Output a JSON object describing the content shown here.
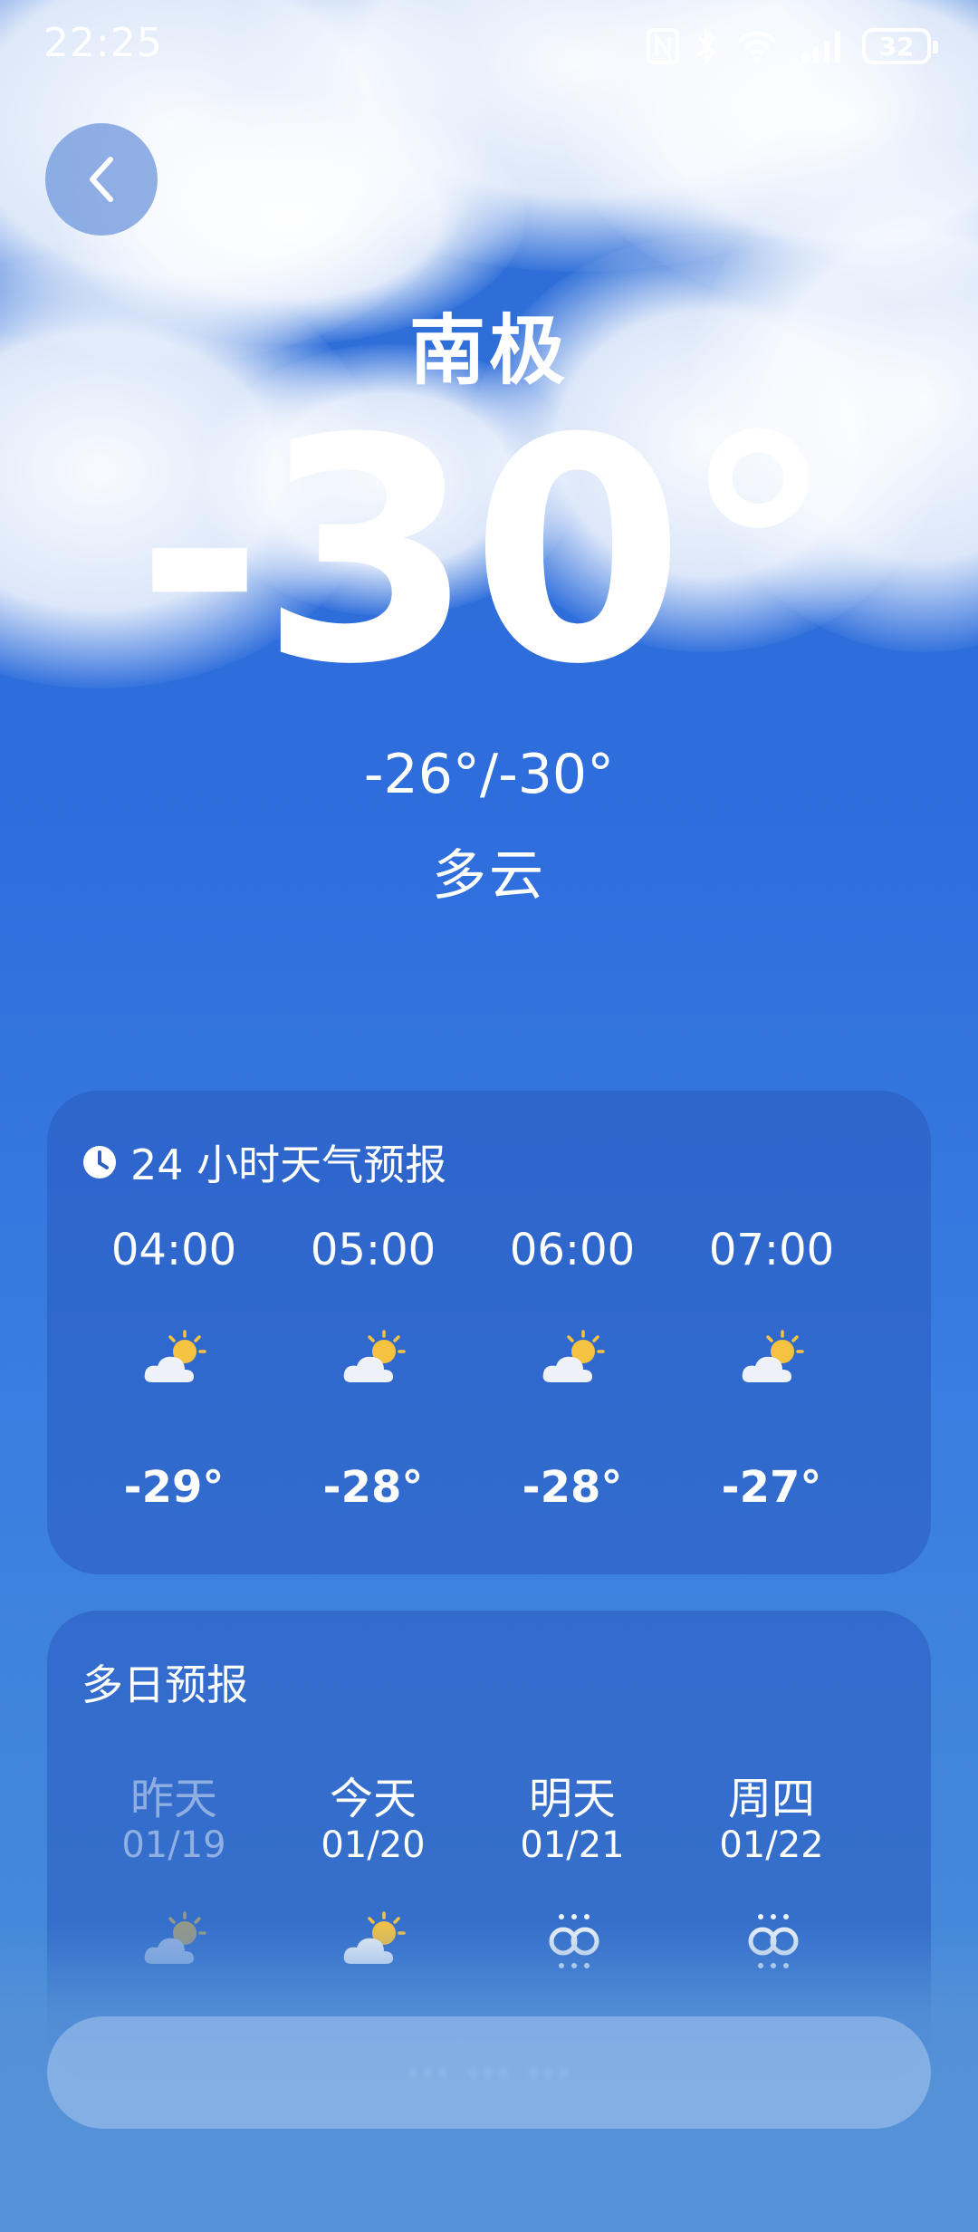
{
  "status_bar": {
    "time": "22:25",
    "battery": "32",
    "icons": [
      "nfc-icon",
      "bluetooth-icon",
      "wifi-icon",
      "signal-5g-icon",
      "battery-icon"
    ]
  },
  "header": {
    "back_icon": "chevron-left-icon"
  },
  "current": {
    "city": "南极",
    "temperature": "-30°",
    "range": "-26°/-30°",
    "condition": "多云"
  },
  "hourly": {
    "title": "24 小时天气预报",
    "title_icon": "clock-icon",
    "items": [
      {
        "time": "04:00",
        "icon": "partly-cloudy-icon",
        "temp": "-29°"
      },
      {
        "time": "05:00",
        "icon": "partly-cloudy-icon",
        "temp": "-28°"
      },
      {
        "time": "06:00",
        "icon": "partly-cloudy-icon",
        "temp": "-28°"
      },
      {
        "time": "07:00",
        "icon": "partly-cloudy-icon",
        "temp": "-27°"
      }
    ]
  },
  "daily": {
    "title": "多日预报",
    "items": [
      {
        "day": "昨天",
        "date": "01/19",
        "icon": "partly-cloudy-icon"
      },
      {
        "day": "今天",
        "date": "01/20",
        "icon": "partly-cloudy-icon"
      },
      {
        "day": "明天",
        "date": "01/21",
        "icon": "snow-icon"
      },
      {
        "day": "周四",
        "date": "01/22",
        "icon": "snow-icon"
      }
    ]
  },
  "colors": {
    "background_top": "#2f6fd6",
    "background_bottom": "#4b8ed8",
    "card": "#2a5abe",
    "sun": "#f5c242"
  }
}
